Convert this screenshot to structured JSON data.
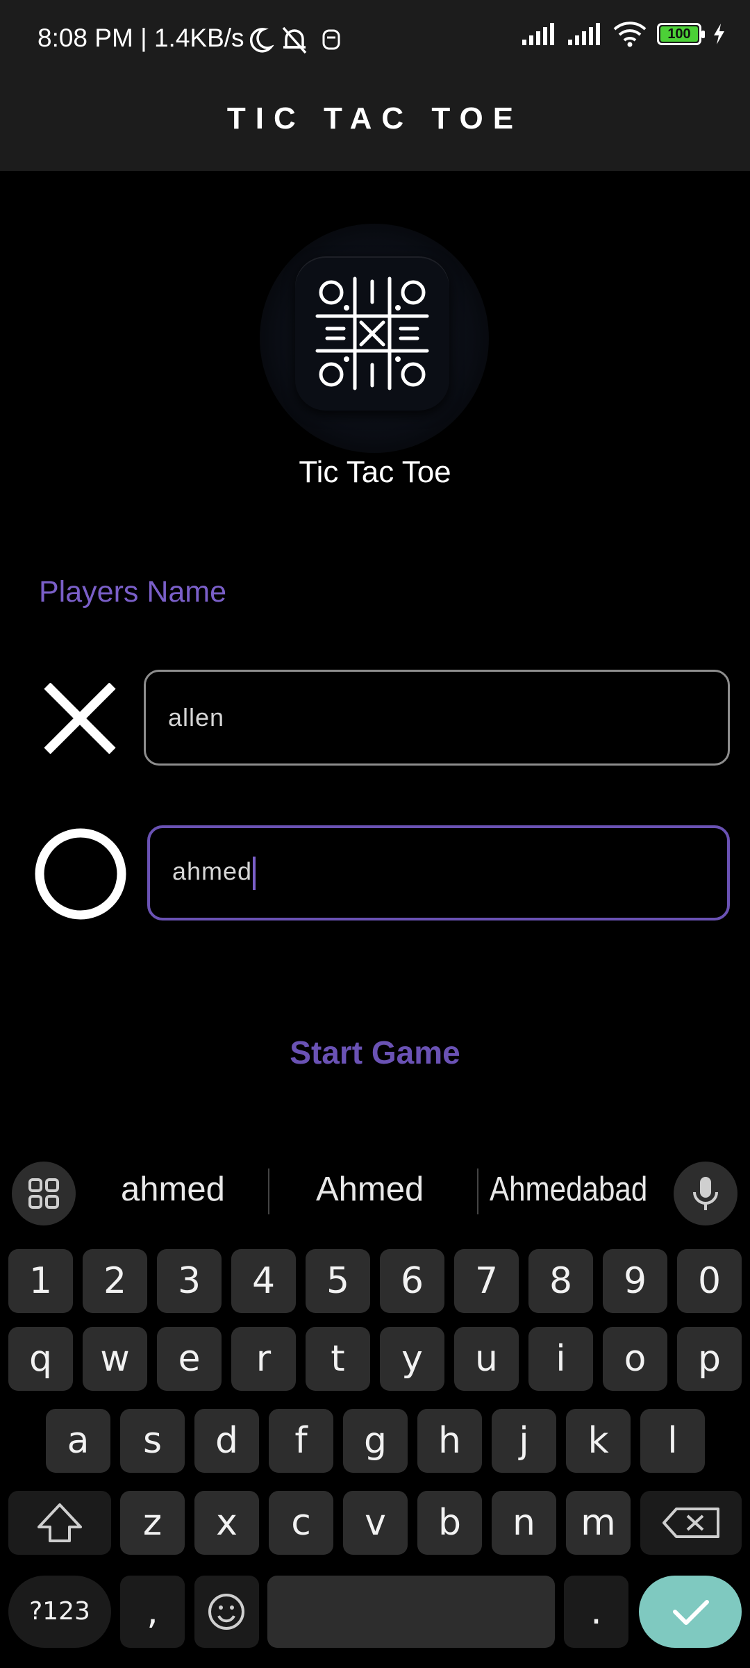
{
  "status_bar": {
    "time": "8:08 PM | 1.4KB/s",
    "battery": "100"
  },
  "app_bar": {
    "title": "TIC TAC TOE"
  },
  "logo": {
    "title": "Tic Tac Toe"
  },
  "players": {
    "section_label": "Players Name",
    "x_name": "allen",
    "o_name": "ahmed"
  },
  "start_button": "Start Game",
  "keyboard": {
    "suggestions": [
      "ahmed",
      "Ahmed",
      "Ahmedabad"
    ],
    "row_numbers": [
      "1",
      "2",
      "3",
      "4",
      "5",
      "6",
      "7",
      "8",
      "9",
      "0"
    ],
    "row_q": [
      "q",
      "w",
      "e",
      "r",
      "t",
      "y",
      "u",
      "i",
      "o",
      "p"
    ],
    "row_a": [
      "a",
      "s",
      "d",
      "f",
      "g",
      "h",
      "j",
      "k",
      "l"
    ],
    "row_z": [
      "z",
      "x",
      "c",
      "v",
      "b",
      "n",
      "m"
    ],
    "symbols_key": "?123",
    "comma": ",",
    "period": "."
  },
  "colors": {
    "accent": "#6a52b4",
    "label_purple": "#7a5fc8",
    "enter_teal": "#7fc9c0",
    "battery_green": "#4cd137"
  }
}
